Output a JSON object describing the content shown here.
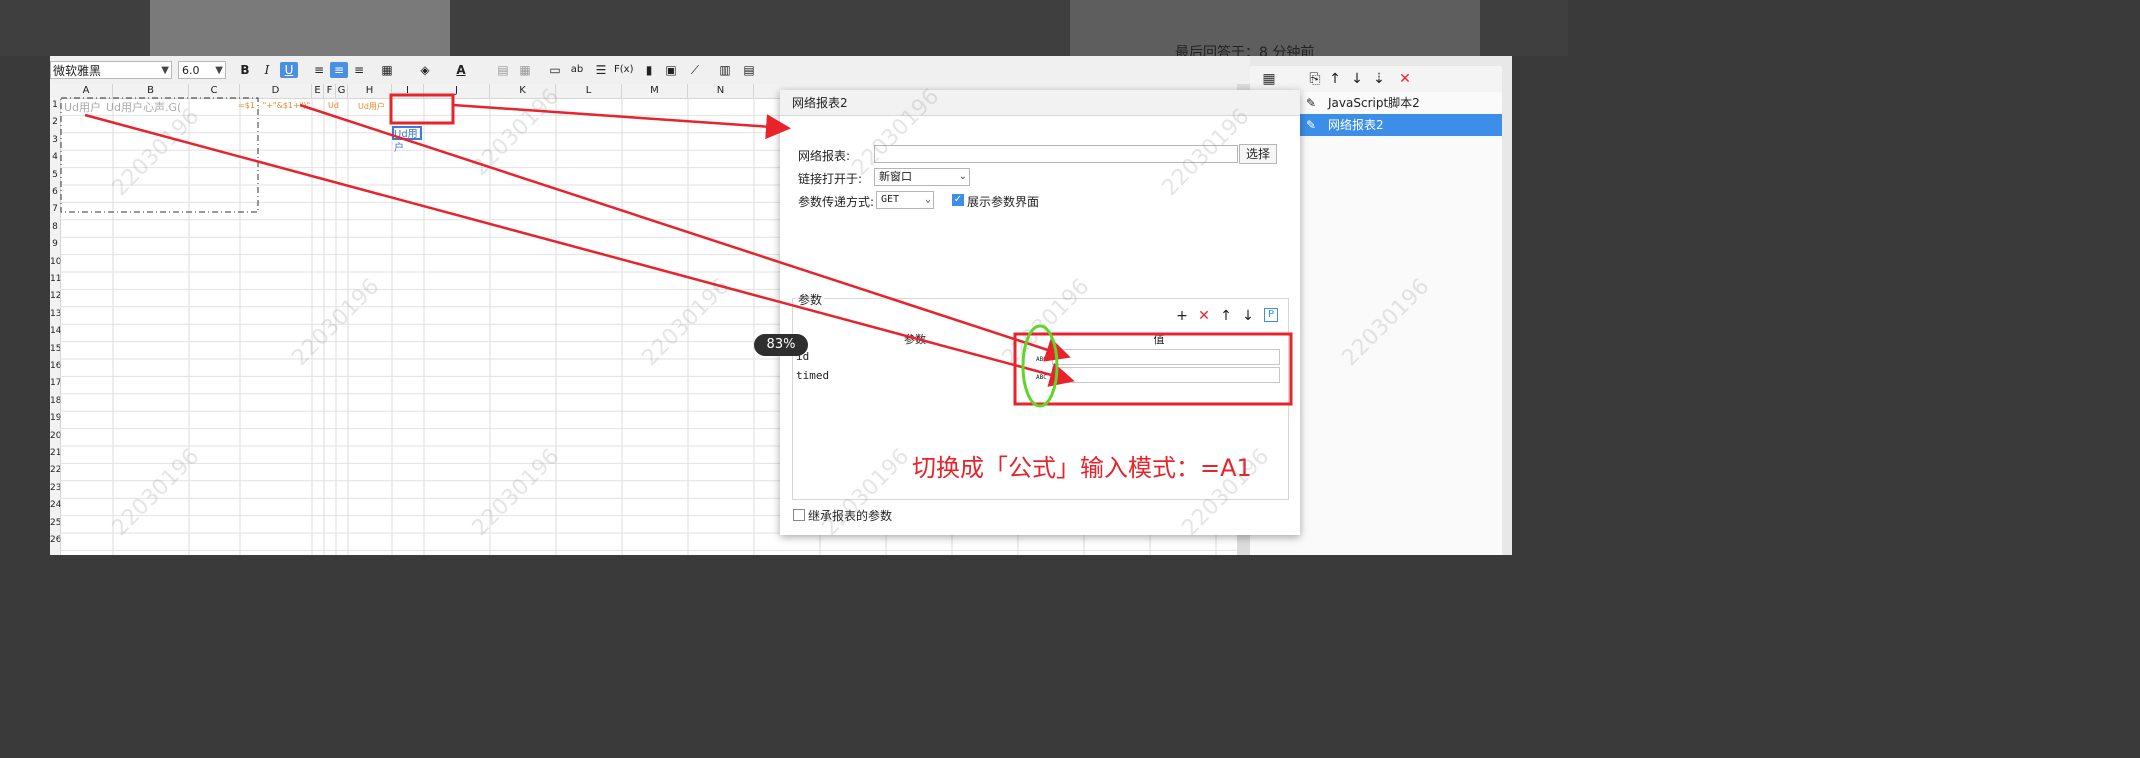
{
  "background": {
    "top_text": "最后回答于：8 分钟前"
  },
  "toolbar": {
    "font_name": "微软雅黑",
    "font_size": "6.0",
    "bold": "B",
    "italic": "I",
    "underline": "U",
    "text_button": "ab",
    "formula_button": "F(x)"
  },
  "sheet": {
    "columns": [
      "A",
      "B",
      "C",
      "D",
      "E",
      "F",
      "G",
      "H",
      "I",
      "J",
      "K",
      "L",
      "M",
      "N"
    ],
    "rows": [
      "1",
      "2",
      "3",
      "4",
      "5",
      "6",
      "7",
      "8",
      "9",
      "10",
      "11",
      "12",
      "13",
      "14",
      "15",
      "16",
      "17",
      "18",
      "19",
      "20",
      "21",
      "22",
      "23",
      "24",
      "25",
      "26"
    ],
    "cell_a1": "Ud用户",
    "cell_b1": "Ud用户心声.G(",
    "cell_d1": "=$1 . \"+\"&$1+\")\"",
    "cell_i1": "Ud用户",
    "cell_e1": "Ud",
    "cell_h1": "Ud用户"
  },
  "dialog": {
    "title": "网络报表2",
    "report_label": "网络报表:",
    "report_value": "",
    "select_button": "选择",
    "open_in_label": "链接打开于:",
    "open_in_value": "新窗口",
    "method_label": "参数传递方式:",
    "method_value": "GET",
    "show_params_label": "展示参数界面",
    "show_params_checked": true,
    "params_section_title": "参数",
    "params_header_name": "参数",
    "params_header_value": "值",
    "params": [
      {
        "name": "id",
        "value": ""
      },
      {
        "name": "timed",
        "value": ""
      }
    ],
    "inherit_label": "继承报表的参数",
    "inherit_checked": false,
    "abc_icon_text": "ABC"
  },
  "right_panel": {
    "items": [
      {
        "label": "JavaScript脚本2",
        "selected": false
      },
      {
        "label": "网络报表2",
        "selected": true
      }
    ]
  },
  "annotation": {
    "text": "切换成「公式」输入模式：=A1",
    "color": "#e8232b",
    "circle_color": "#5fd62a"
  },
  "zoom_badge": "83%",
  "watermark": "22030196"
}
